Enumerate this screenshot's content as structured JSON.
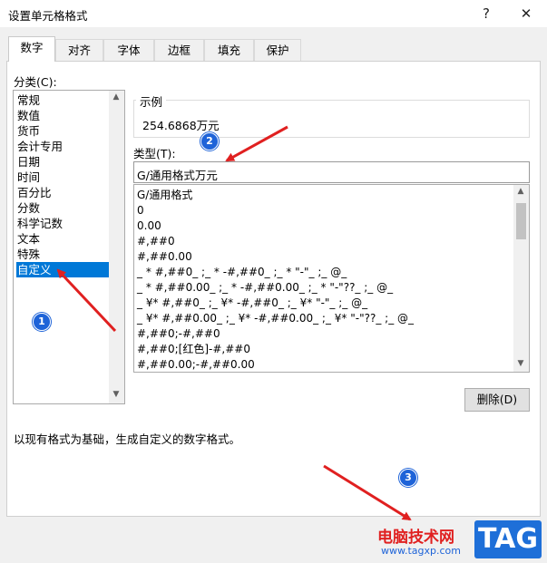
{
  "window": {
    "title": "设置单元格格式",
    "help_glyph": "?",
    "close_glyph": "✕"
  },
  "tabs": [
    {
      "label": "数字",
      "active": true
    },
    {
      "label": "对齐"
    },
    {
      "label": "字体"
    },
    {
      "label": "边框"
    },
    {
      "label": "填充"
    },
    {
      "label": "保护"
    }
  ],
  "category": {
    "label": "分类(C):",
    "items": [
      "常规",
      "数值",
      "货币",
      "会计专用",
      "日期",
      "时间",
      "百分比",
      "分数",
      "科学记数",
      "文本",
      "特殊",
      "自定义"
    ],
    "selected": "自定义"
  },
  "sample": {
    "label": "示例",
    "value": "254.6868万元"
  },
  "type": {
    "label": "类型(T):",
    "value": "G/通用格式万元"
  },
  "formats": [
    "G/通用格式",
    "0",
    "0.00",
    "#,##0",
    "#,##0.00",
    "_ * #,##0_ ;_ * -#,##0_ ;_ * \"-\"_ ;_ @_",
    "_ * #,##0.00_ ;_ * -#,##0.00_ ;_ * \"-\"??_ ;_ @_",
    "_ ¥* #,##0_ ;_ ¥* -#,##0_ ;_ ¥* \"-\"_ ;_ @_",
    "_ ¥* #,##0.00_ ;_ ¥* -#,##0.00_ ;_ ¥* \"-\"??_ ;_ @_",
    "#,##0;-#,##0",
    "#,##0;[红色]-#,##0",
    "#,##0.00;-#,##0.00"
  ],
  "delete_button": "删除(D)",
  "description": "以现有格式为基础，生成自定义的数字格式。",
  "annotations": {
    "badge1": "1",
    "badge2": "2",
    "badge3": "3",
    "arrow_color": "#e02020",
    "badge_color": "#1e63d8"
  },
  "watermark": {
    "site_cn": "电脑技术网",
    "site_url": "www.tagxp.com",
    "tag": "TAG"
  },
  "colors": {
    "accent": "#0078d7",
    "dialog_bg": "#f0f0f0"
  }
}
